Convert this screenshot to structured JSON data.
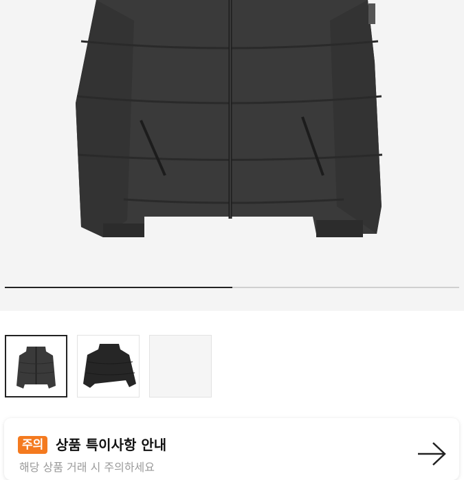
{
  "gallery": {
    "progress_fraction": 0.5,
    "thumbnails": [
      {
        "kind": "jacket-front",
        "selected": true
      },
      {
        "kind": "jacket-side",
        "selected": false
      },
      {
        "kind": "empty",
        "selected": false
      }
    ]
  },
  "notice": {
    "badge": "주의",
    "title": "상품 특이사항 안내",
    "subtitle": "해당 상품 거래 시 주의하세요",
    "arrow_icon": "arrow-right-icon"
  },
  "colors": {
    "accent": "#f47a1f",
    "jacket": "#3a3a3a"
  }
}
